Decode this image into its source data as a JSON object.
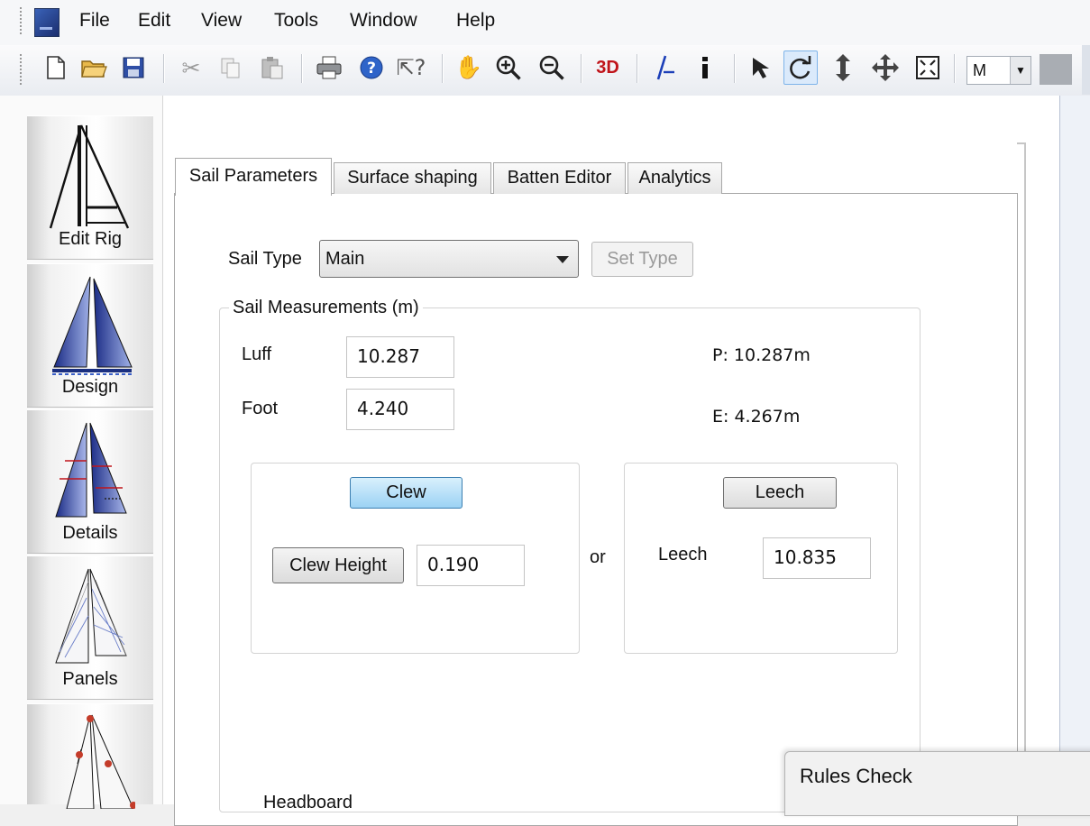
{
  "menu": [
    "File",
    "Edit",
    "View",
    "Tools",
    "Window",
    "Help"
  ],
  "toolbar": {
    "mode_value": "M",
    "items": [
      "new-file",
      "open-folder",
      "save",
      "cut",
      "copy",
      "paste",
      "print",
      "help",
      "context-help",
      "pan",
      "zoom-in",
      "zoom-out",
      "3d-view",
      "axis",
      "info",
      "select-arrow",
      "rotate",
      "vertical-move",
      "move",
      "fit-to-view"
    ],
    "threeD_label": "3D"
  },
  "nav": [
    "Edit Rig",
    "Design",
    "Details",
    "Panels"
  ],
  "tabs": [
    "Sail Parameters",
    "Surface shaping",
    "Batten Editor",
    "Analytics"
  ],
  "sail_type": {
    "label": "Sail Type",
    "value": "Main",
    "set_button": "Set Type"
  },
  "measurements": {
    "legend": "Sail Measurements (m)",
    "luff_label": "Luff",
    "luff_value": "10.287",
    "foot_label": "Foot",
    "foot_value": "4.240",
    "p_text": "P: 10.287m",
    "e_text": "E: 4.267m"
  },
  "clew": {
    "button": "Clew",
    "height_button": "Clew Height",
    "height_value": "0.190"
  },
  "or_text": "or",
  "leech": {
    "button": "Leech",
    "label": "Leech",
    "value": "10.835"
  },
  "headboard_label": "Headboard",
  "rules_check": "Rules Check",
  "colors": {
    "accent": "#9bd2f4",
    "sail_blue": "#2a3f9a",
    "toolbar_red": "#c0141a"
  }
}
